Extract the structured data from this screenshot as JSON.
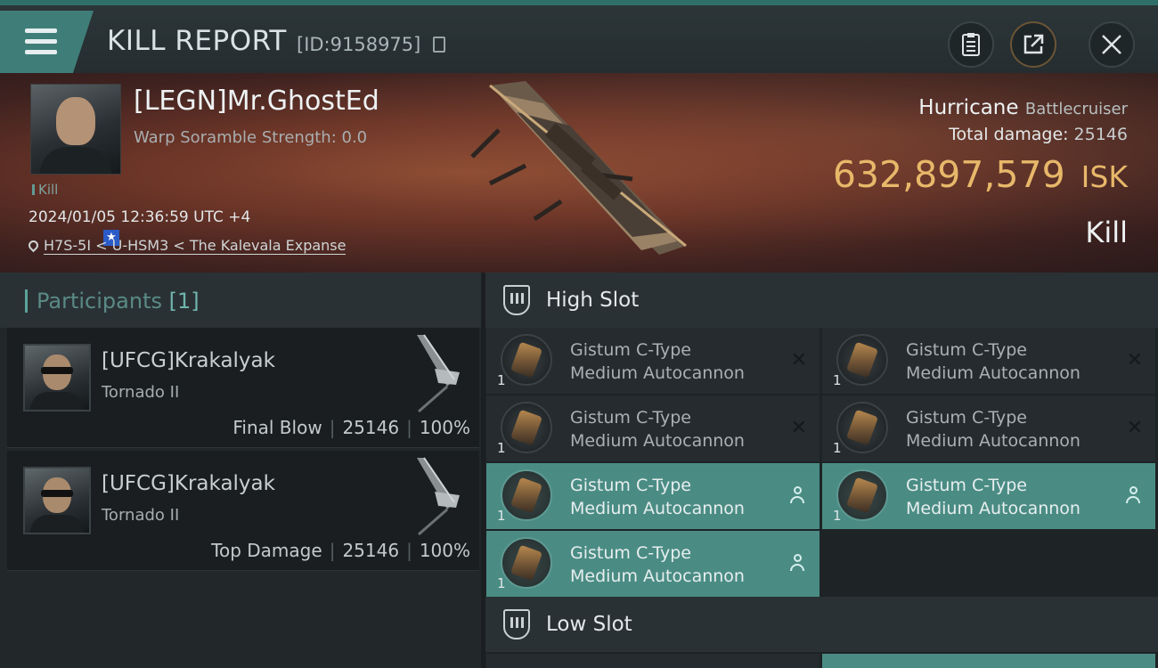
{
  "header": {
    "title": "KILL REPORT",
    "report_id": "[ID:9158975]",
    "buttons": [
      "clipboard-icon",
      "share-icon",
      "close-icon"
    ]
  },
  "victim": {
    "name": "[LEGN]Mr.GhostEd",
    "warp_scramble": "Warp Soramble Strength: 0.0",
    "kill_tag": "Kill",
    "timestamp": "2024/01/05 12:36:59 UTC +4",
    "location": "H7S-5I < U-HSM3 < The Kalevala Expanse",
    "ship_name": "Hurricane",
    "ship_class": "Battlecruiser",
    "total_damage_label": "Total damage:",
    "total_damage_value": "25146",
    "isk_value": "632,897,579",
    "isk_unit": "ISK",
    "result": "Kill"
  },
  "participants": {
    "label": "Participants",
    "count": "[1]",
    "rows": [
      {
        "name": "[UFCG]Krakalyak",
        "ship": "Tornado II",
        "role": "Final Blow",
        "damage": "25146",
        "percent": "100%"
      },
      {
        "name": "[UFCG]Krakalyak",
        "ship": "Tornado II",
        "role": "Top Damage",
        "damage": "25146",
        "percent": "100%"
      }
    ]
  },
  "slots": {
    "high_title": "High Slot",
    "low_title": "Low Slot",
    "modules": [
      {
        "line1": "Gistum C-Type",
        "line2": "Medium Autocannon",
        "qty": "1",
        "state": "destroyed"
      },
      {
        "line1": "Gistum C-Type",
        "line2": "Medium Autocannon",
        "qty": "1",
        "state": "destroyed"
      },
      {
        "line1": "Gistum C-Type",
        "line2": "Medium Autocannon",
        "qty": "1",
        "state": "destroyed"
      },
      {
        "line1": "Gistum C-Type",
        "line2": "Medium Autocannon",
        "qty": "1",
        "state": "destroyed"
      },
      {
        "line1": "Gistum C-Type",
        "line2": "Medium Autocannon",
        "qty": "1",
        "state": "dropped"
      },
      {
        "line1": "Gistum C-Type",
        "line2": "Medium Autocannon",
        "qty": "1",
        "state": "dropped"
      },
      {
        "line1": "Gistum C-Type",
        "line2": "Medium Autocannon",
        "qty": "1",
        "state": "dropped"
      }
    ]
  },
  "colors": {
    "accent": "#4a8c84",
    "isk": "#e8b86a",
    "banner": "#6a3427"
  }
}
